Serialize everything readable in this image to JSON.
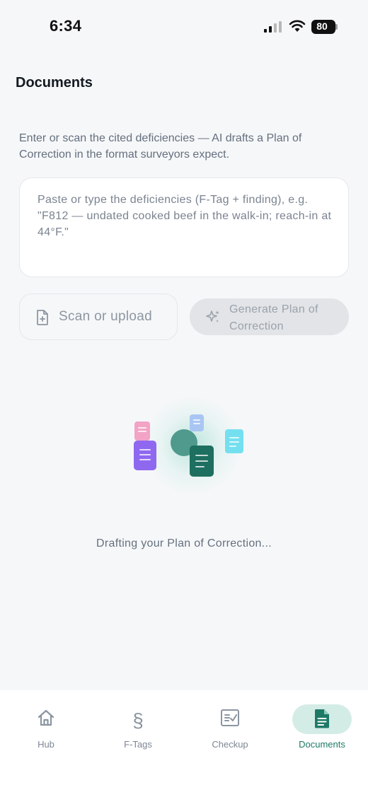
{
  "status_bar": {
    "time": "6:34",
    "battery": "80"
  },
  "header": {
    "title": "Documents"
  },
  "intro": "Enter or scan the cited deficiencies — AI drafts a Plan of Correction in the format surveyors expect.",
  "input": {
    "placeholder": "Paste or type the deficiencies (F-Tag + finding), e.g. \"F812 — undated cooked beef in the walk-in; reach-in at 44°F.\""
  },
  "actions": {
    "scan_label": "Scan or upload",
    "generate_label": "Generate Plan of Correction"
  },
  "loading": {
    "text": "Drafting your Plan of Correction..."
  },
  "tabs": [
    {
      "label": "Hub",
      "icon": "home-icon"
    },
    {
      "label": "F-Tags",
      "icon": "section-icon"
    },
    {
      "label": "Checkup",
      "icon": "checklist-icon"
    },
    {
      "label": "Documents",
      "icon": "document-icon",
      "active": true
    }
  ],
  "colors": {
    "accent": "#1e7a67",
    "accent_soft": "#d4ece6",
    "background": "#f6f7f9"
  }
}
